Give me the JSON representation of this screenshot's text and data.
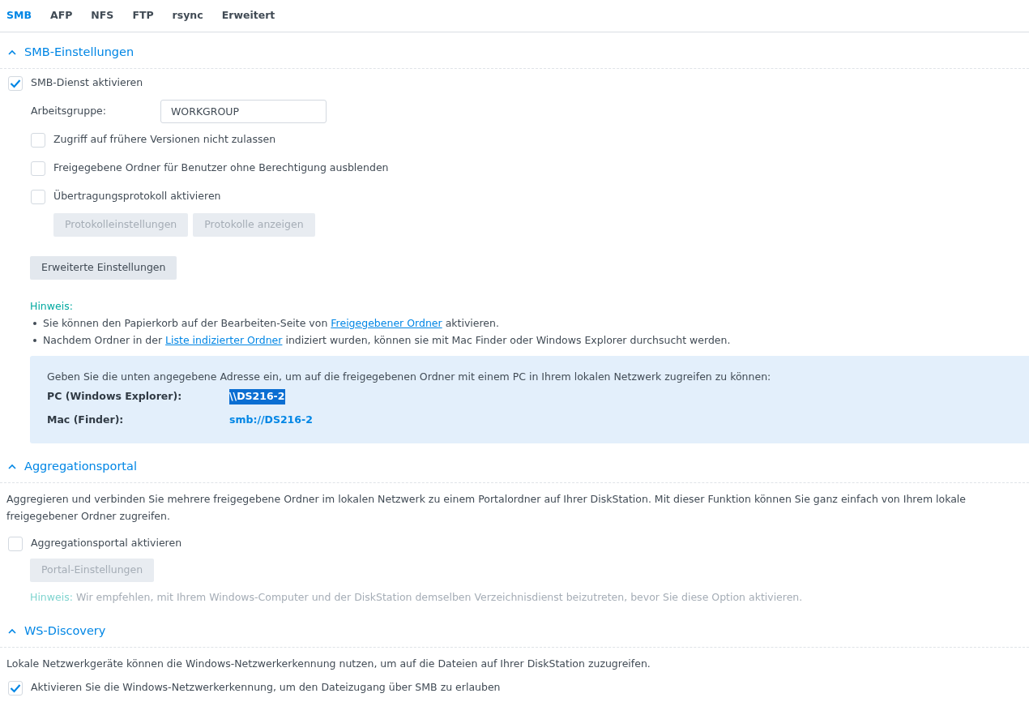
{
  "tabs": [
    {
      "label": "SMB",
      "selected": true
    },
    {
      "label": "AFP",
      "selected": false
    },
    {
      "label": "NFS",
      "selected": false
    },
    {
      "label": "FTP",
      "selected": false
    },
    {
      "label": "rsync",
      "selected": false
    },
    {
      "label": "Erweitert",
      "selected": false
    }
  ],
  "smb_settings": {
    "title": "SMB-Einstellungen",
    "expanded": true,
    "enable": {
      "label": "SMB-Dienst aktivieren",
      "checked": true
    },
    "workgroup": {
      "label": "Arbeitsgruppe:",
      "value": "WORKGROUP"
    },
    "options": [
      {
        "label": "Zugriff auf frühere Versionen nicht zulassen",
        "checked": false
      },
      {
        "label": "Freigegebene Ordner für Benutzer ohne Berechtigung ausblenden",
        "checked": false
      },
      {
        "label": "Übertragungsprotokoll aktivieren",
        "checked": false
      }
    ],
    "log_buttons": [
      {
        "label": "Protokolleinstellungen",
        "disabled": true
      },
      {
        "label": "Protokolle anzeigen",
        "disabled": true
      }
    ],
    "advanced_button": {
      "label": "Erweiterte Einstellungen",
      "disabled": false
    },
    "note": {
      "title": "Hinweis:",
      "items": [
        [
          {
            "kind": "text",
            "text": "Sie können den Papierkorb auf der Bearbeiten-Seite von "
          },
          {
            "kind": "link",
            "text": "Freigegebener Ordner"
          },
          {
            "kind": "text",
            "text": " aktivieren."
          }
        ],
        [
          {
            "kind": "text",
            "text": "Nachdem Ordner in der "
          },
          {
            "kind": "link",
            "text": "Liste indizierter Ordner"
          },
          {
            "kind": "text",
            "text": " indiziert wurden, können sie mit Mac Finder oder Windows Explorer durchsucht werden."
          }
        ]
      ]
    },
    "address_box": {
      "intro": "Geben Sie die unten angegebene Adresse ein, um auf die freigegebenen Ordner mit einem PC in Ihrem lokalen Netzwerk zugreifen zu können:",
      "rows": [
        {
          "label": "PC (Windows Explorer):",
          "value": "\\\\DS216-2",
          "selected": true
        },
        {
          "label": "Mac (Finder):",
          "value": "smb://DS216-2",
          "selected": false
        }
      ]
    }
  },
  "aggregation_portal": {
    "title": "Aggregationsportal",
    "expanded": true,
    "description_lines": [
      "Aggregieren und verbinden Sie mehrere freigegebene Ordner im lokalen Netzwerk zu einem Portalordner auf Ihrer DiskStation. Mit dieser Funktion können Sie ganz einfach von Ihrem lokale",
      "freigegebener Ordner zugreifen."
    ],
    "enable": {
      "label": "Aggregationsportal aktivieren",
      "checked": false
    },
    "button": {
      "label": "Portal-Einstellungen",
      "disabled": true
    },
    "hint": {
      "label": "Hinweis:",
      "text": "Wir empfehlen, mit Ihrem Windows-Computer und der DiskStation demselben Verzeichnisdienst beizutreten, bevor Sie diese Option aktivieren.",
      "disabled": true
    }
  },
  "ws_discovery": {
    "title": "WS-Discovery",
    "expanded": true,
    "description": "Lokale Netzwerkgeräte können die Windows-Netzwerkerkennung nutzen, um auf die Dateien auf Ihrer DiskStation zuzugreifen.",
    "enable": {
      "label": "Aktivieren Sie die Windows-Netzwerkerkennung, um den Dateizugang über SMB zu erlauben",
      "checked": true
    }
  }
}
